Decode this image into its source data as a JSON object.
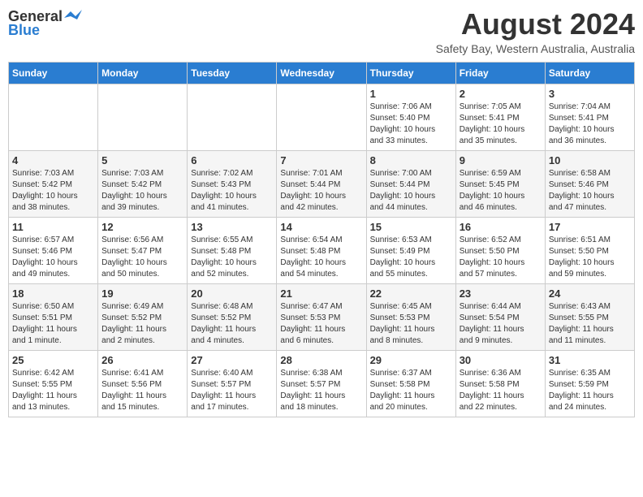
{
  "header": {
    "logo_general": "General",
    "logo_blue": "Blue",
    "month_year": "August 2024",
    "location": "Safety Bay, Western Australia, Australia"
  },
  "days_of_week": [
    "Sunday",
    "Monday",
    "Tuesday",
    "Wednesday",
    "Thursday",
    "Friday",
    "Saturday"
  ],
  "weeks": [
    [
      {
        "day": "",
        "info": ""
      },
      {
        "day": "",
        "info": ""
      },
      {
        "day": "",
        "info": ""
      },
      {
        "day": "",
        "info": ""
      },
      {
        "day": "1",
        "info": "Sunrise: 7:06 AM\nSunset: 5:40 PM\nDaylight: 10 hours\nand 33 minutes."
      },
      {
        "day": "2",
        "info": "Sunrise: 7:05 AM\nSunset: 5:41 PM\nDaylight: 10 hours\nand 35 minutes."
      },
      {
        "day": "3",
        "info": "Sunrise: 7:04 AM\nSunset: 5:41 PM\nDaylight: 10 hours\nand 36 minutes."
      }
    ],
    [
      {
        "day": "4",
        "info": "Sunrise: 7:03 AM\nSunset: 5:42 PM\nDaylight: 10 hours\nand 38 minutes."
      },
      {
        "day": "5",
        "info": "Sunrise: 7:03 AM\nSunset: 5:42 PM\nDaylight: 10 hours\nand 39 minutes."
      },
      {
        "day": "6",
        "info": "Sunrise: 7:02 AM\nSunset: 5:43 PM\nDaylight: 10 hours\nand 41 minutes."
      },
      {
        "day": "7",
        "info": "Sunrise: 7:01 AM\nSunset: 5:44 PM\nDaylight: 10 hours\nand 42 minutes."
      },
      {
        "day": "8",
        "info": "Sunrise: 7:00 AM\nSunset: 5:44 PM\nDaylight: 10 hours\nand 44 minutes."
      },
      {
        "day": "9",
        "info": "Sunrise: 6:59 AM\nSunset: 5:45 PM\nDaylight: 10 hours\nand 46 minutes."
      },
      {
        "day": "10",
        "info": "Sunrise: 6:58 AM\nSunset: 5:46 PM\nDaylight: 10 hours\nand 47 minutes."
      }
    ],
    [
      {
        "day": "11",
        "info": "Sunrise: 6:57 AM\nSunset: 5:46 PM\nDaylight: 10 hours\nand 49 minutes."
      },
      {
        "day": "12",
        "info": "Sunrise: 6:56 AM\nSunset: 5:47 PM\nDaylight: 10 hours\nand 50 minutes."
      },
      {
        "day": "13",
        "info": "Sunrise: 6:55 AM\nSunset: 5:48 PM\nDaylight: 10 hours\nand 52 minutes."
      },
      {
        "day": "14",
        "info": "Sunrise: 6:54 AM\nSunset: 5:48 PM\nDaylight: 10 hours\nand 54 minutes."
      },
      {
        "day": "15",
        "info": "Sunrise: 6:53 AM\nSunset: 5:49 PM\nDaylight: 10 hours\nand 55 minutes."
      },
      {
        "day": "16",
        "info": "Sunrise: 6:52 AM\nSunset: 5:50 PM\nDaylight: 10 hours\nand 57 minutes."
      },
      {
        "day": "17",
        "info": "Sunrise: 6:51 AM\nSunset: 5:50 PM\nDaylight: 10 hours\nand 59 minutes."
      }
    ],
    [
      {
        "day": "18",
        "info": "Sunrise: 6:50 AM\nSunset: 5:51 PM\nDaylight: 11 hours\nand 1 minute."
      },
      {
        "day": "19",
        "info": "Sunrise: 6:49 AM\nSunset: 5:52 PM\nDaylight: 11 hours\nand 2 minutes."
      },
      {
        "day": "20",
        "info": "Sunrise: 6:48 AM\nSunset: 5:52 PM\nDaylight: 11 hours\nand 4 minutes."
      },
      {
        "day": "21",
        "info": "Sunrise: 6:47 AM\nSunset: 5:53 PM\nDaylight: 11 hours\nand 6 minutes."
      },
      {
        "day": "22",
        "info": "Sunrise: 6:45 AM\nSunset: 5:53 PM\nDaylight: 11 hours\nand 8 minutes."
      },
      {
        "day": "23",
        "info": "Sunrise: 6:44 AM\nSunset: 5:54 PM\nDaylight: 11 hours\nand 9 minutes."
      },
      {
        "day": "24",
        "info": "Sunrise: 6:43 AM\nSunset: 5:55 PM\nDaylight: 11 hours\nand 11 minutes."
      }
    ],
    [
      {
        "day": "25",
        "info": "Sunrise: 6:42 AM\nSunset: 5:55 PM\nDaylight: 11 hours\nand 13 minutes."
      },
      {
        "day": "26",
        "info": "Sunrise: 6:41 AM\nSunset: 5:56 PM\nDaylight: 11 hours\nand 15 minutes."
      },
      {
        "day": "27",
        "info": "Sunrise: 6:40 AM\nSunset: 5:57 PM\nDaylight: 11 hours\nand 17 minutes."
      },
      {
        "day": "28",
        "info": "Sunrise: 6:38 AM\nSunset: 5:57 PM\nDaylight: 11 hours\nand 18 minutes."
      },
      {
        "day": "29",
        "info": "Sunrise: 6:37 AM\nSunset: 5:58 PM\nDaylight: 11 hours\nand 20 minutes."
      },
      {
        "day": "30",
        "info": "Sunrise: 6:36 AM\nSunset: 5:58 PM\nDaylight: 11 hours\nand 22 minutes."
      },
      {
        "day": "31",
        "info": "Sunrise: 6:35 AM\nSunset: 5:59 PM\nDaylight: 11 hours\nand 24 minutes."
      }
    ]
  ]
}
